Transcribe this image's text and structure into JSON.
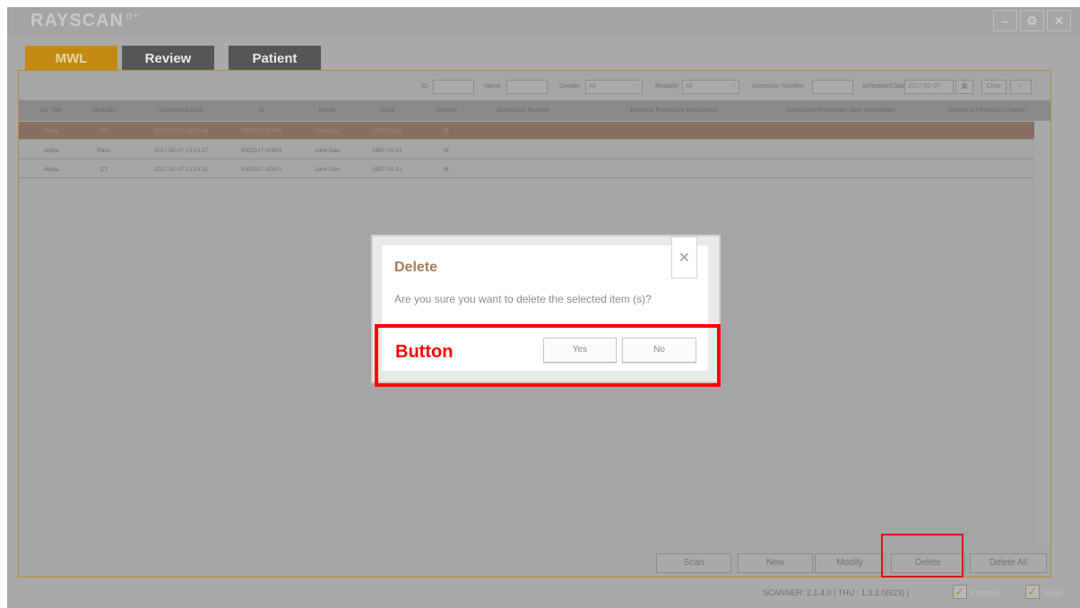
{
  "app": {
    "logo_text": "RAYSCAN",
    "logo_suffix": "α+",
    "window_controls": [
      "minimize-icon",
      "settings-icon",
      "close-icon"
    ]
  },
  "tabs": [
    {
      "label": "MWL",
      "active": true
    },
    {
      "label": "Review",
      "active": false
    },
    {
      "label": "Patient",
      "active": false
    }
  ],
  "filters": {
    "id_label": "ID",
    "id_value": "",
    "name_label": "Name",
    "name_value": "",
    "gender_label": "Gender",
    "gender_value": "All",
    "modality_label": "Modality",
    "modality_value": "All",
    "accession_label": "Accession Number",
    "accession_value": "",
    "date_label": "Scheduled Date",
    "date_value": "2017-02-07",
    "clear_label": "Clear",
    "search_icon": "search-icon"
  },
  "table": {
    "headers": [
      "AE Title",
      "Modality",
      "Scheduled Date",
      "ID",
      "Name",
      "DOB",
      "Gender",
      "Accession Number",
      "Request Procedure Description",
      "Scheduled Procedure Step Description",
      "Referring Physician's Name"
    ],
    "rows": [
      [
        "Alpha",
        "DX",
        "2017-02-07 13:10:06",
        "PID2017-00001",
        "John Doe",
        "1997-01-01",
        "M",
        "",
        "",
        "",
        ""
      ],
      [
        "Alpha",
        "Pano",
        "2017-02-07 13:10:17",
        "PID2017-00001",
        "John Doe",
        "1997-01-01",
        "M",
        "",
        "",
        "",
        ""
      ],
      [
        "Alpha",
        "CT",
        "2017-02-07 13:10:31",
        "PID2017-00001",
        "John Doe",
        "1997-01-01",
        "M",
        "",
        "",
        "",
        ""
      ]
    ]
  },
  "actions": {
    "scan": "Scan",
    "new": "New",
    "modify": "Modify",
    "delete": "Delete",
    "delete_all": "Delete All"
  },
  "status": {
    "version": "SCANNER: 2.1.4.0 | THU : 1.3.2.0(623) |",
    "receive": "Receive",
    "send": "Send"
  },
  "dialog": {
    "title": "Delete",
    "message": "Are you sure you want to delete the selected item (s)?",
    "yes": "Yes",
    "no": "No"
  },
  "annotation": {
    "label": "Button",
    "color": "#ff0000"
  }
}
